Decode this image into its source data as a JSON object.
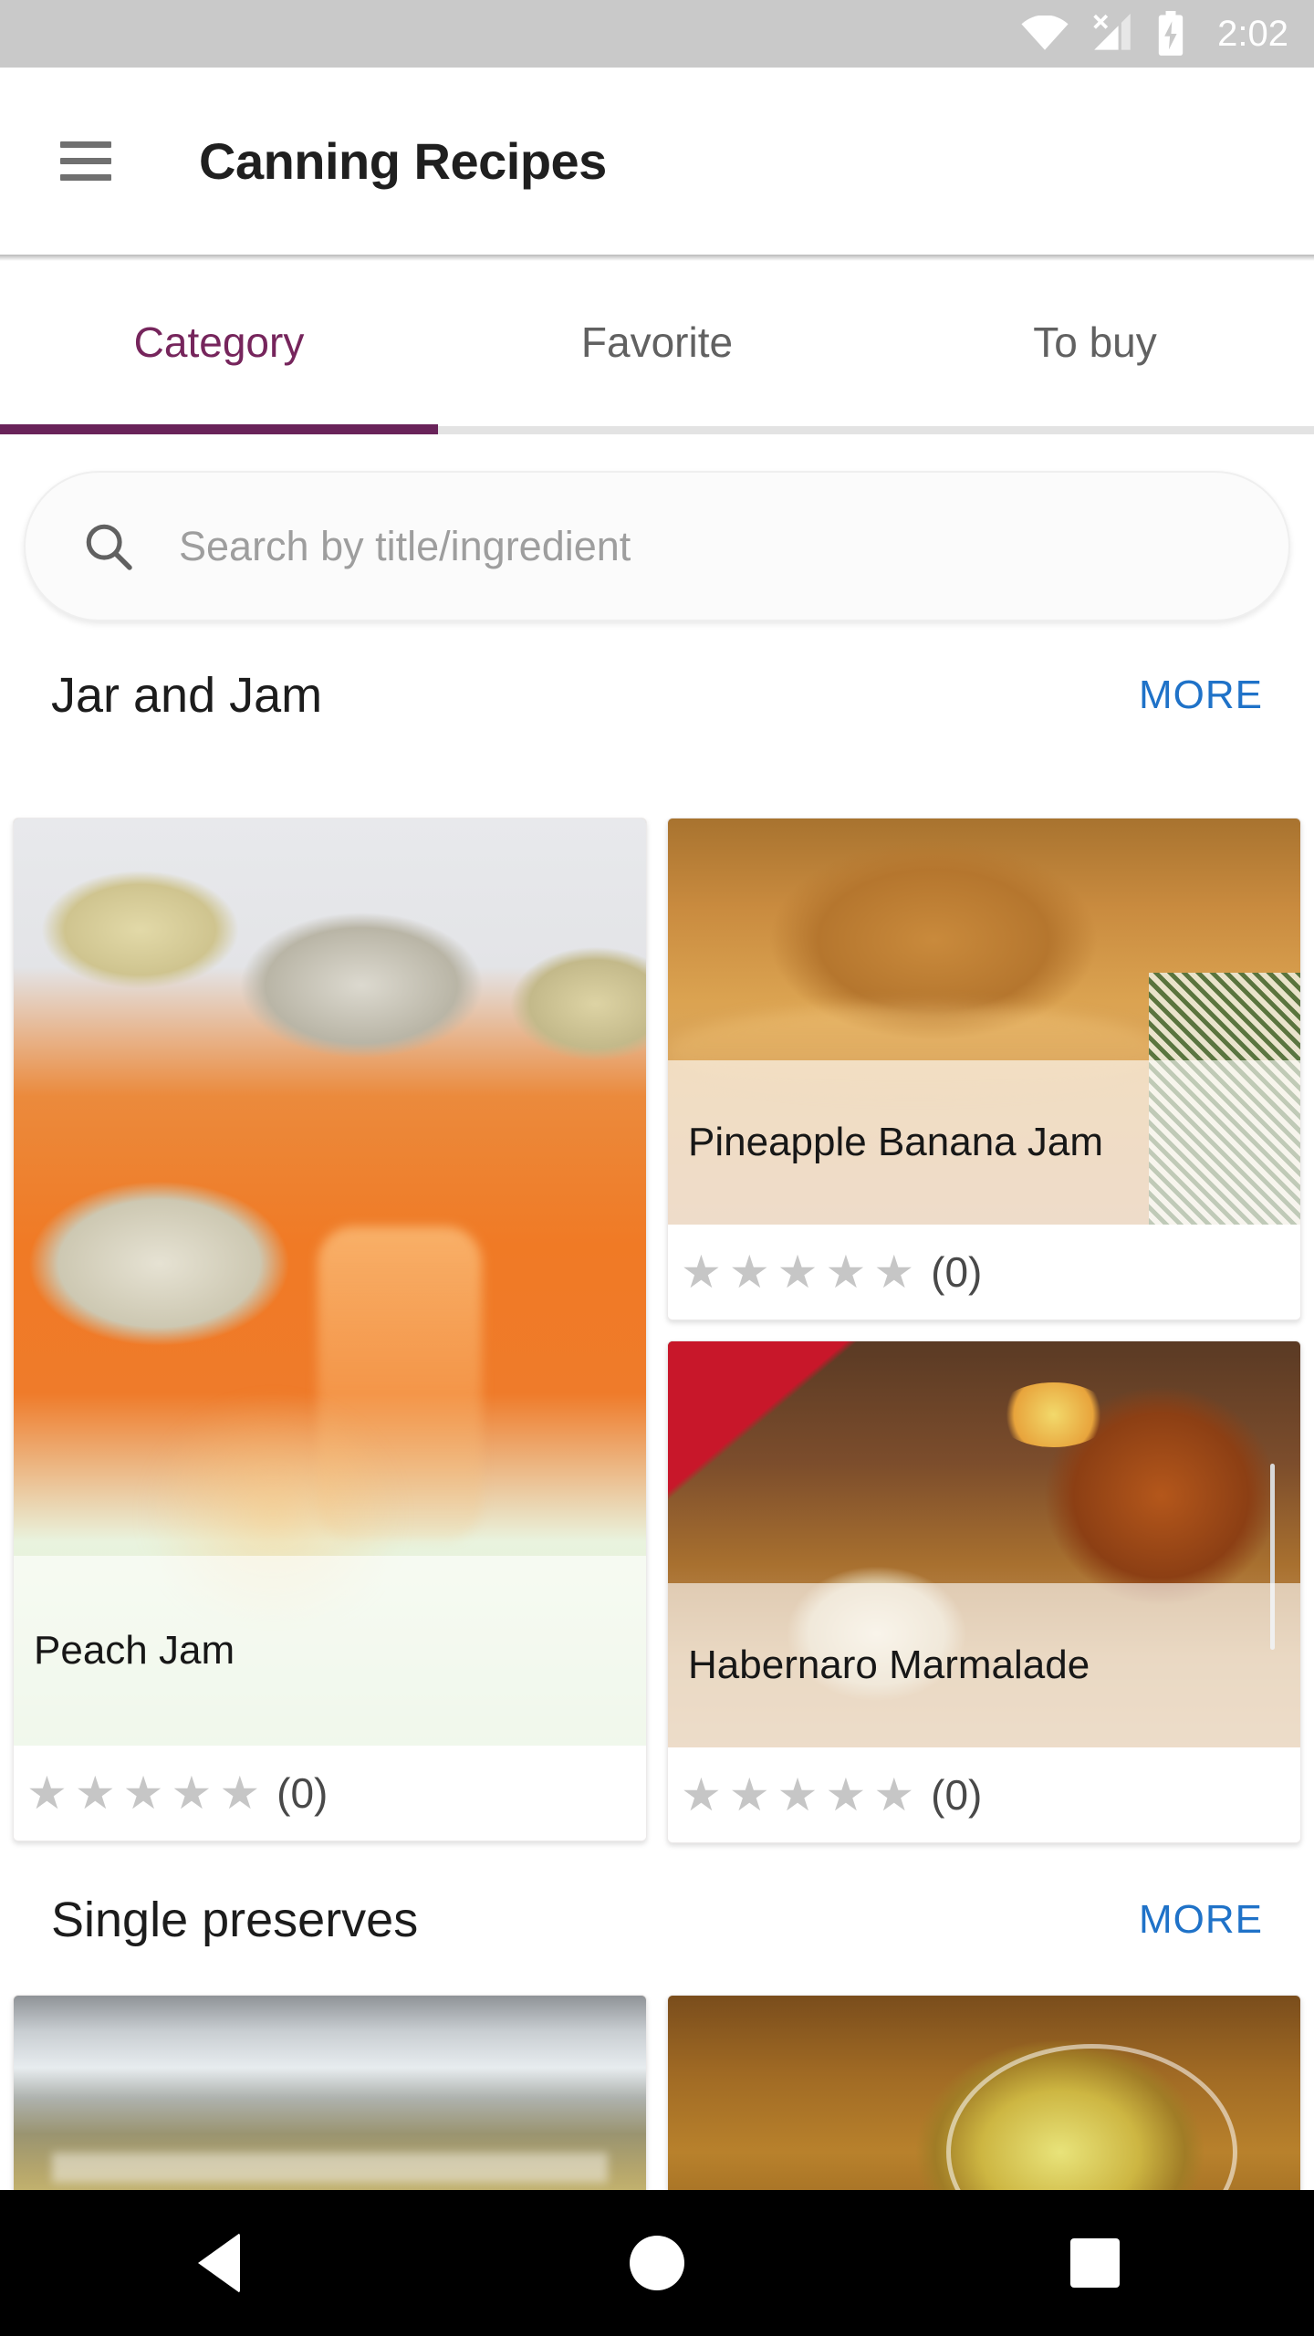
{
  "status_bar": {
    "time": "2:02",
    "icons": [
      "wifi-icon",
      "cellular-no-sim-icon",
      "battery-charging-icon"
    ],
    "background": "#c9c9c9"
  },
  "app_bar": {
    "menu_icon": "hamburger-menu-icon",
    "title": "Canning Recipes"
  },
  "tabs": {
    "active_index": 0,
    "accent_color": "#69235a",
    "items": [
      {
        "label": "Category"
      },
      {
        "label": "Favorite"
      },
      {
        "label": "To buy"
      }
    ]
  },
  "search": {
    "icon": "search-icon",
    "placeholder": "Search by title/ingredient",
    "value": ""
  },
  "sections": [
    {
      "title": "Jar and Jam",
      "more_label": "MORE",
      "more_color": "#1f72c8",
      "cards": [
        {
          "title": "Peach Jam",
          "rating": 0,
          "rating_count": "(0)",
          "stars": 5,
          "image": "mason-jars-of-orange-peach-jam"
        },
        {
          "title": "Pineapple Banana Jam",
          "rating": 0,
          "rating_count": "(0)",
          "stars": 5,
          "image": "open-jar-of-pineapple-banana-jam"
        },
        {
          "title": "Habernaro Marmalade",
          "rating": 0,
          "rating_count": "(0)",
          "stars": 5,
          "image": "marmalade-jar-with-red-cloth-and-bread"
        }
      ]
    },
    {
      "title": "Single preserves",
      "more_label": "MORE",
      "more_color": "#1f72c8",
      "cards": [
        {
          "title": "",
          "rating": 0,
          "rating_count": "",
          "stars": 0,
          "image": "metal-lid-jar-of-preserves"
        },
        {
          "title": "",
          "rating": 0,
          "rating_count": "",
          "stars": 0,
          "image": "jar-of-pickled-yellow-preserves"
        }
      ]
    }
  ],
  "nav_bar": {
    "buttons": [
      {
        "name": "back",
        "icon": "triangle-back-icon"
      },
      {
        "name": "home",
        "icon": "circle-home-icon"
      },
      {
        "name": "recents",
        "icon": "square-recents-icon"
      }
    ]
  },
  "star_glyph": "★"
}
